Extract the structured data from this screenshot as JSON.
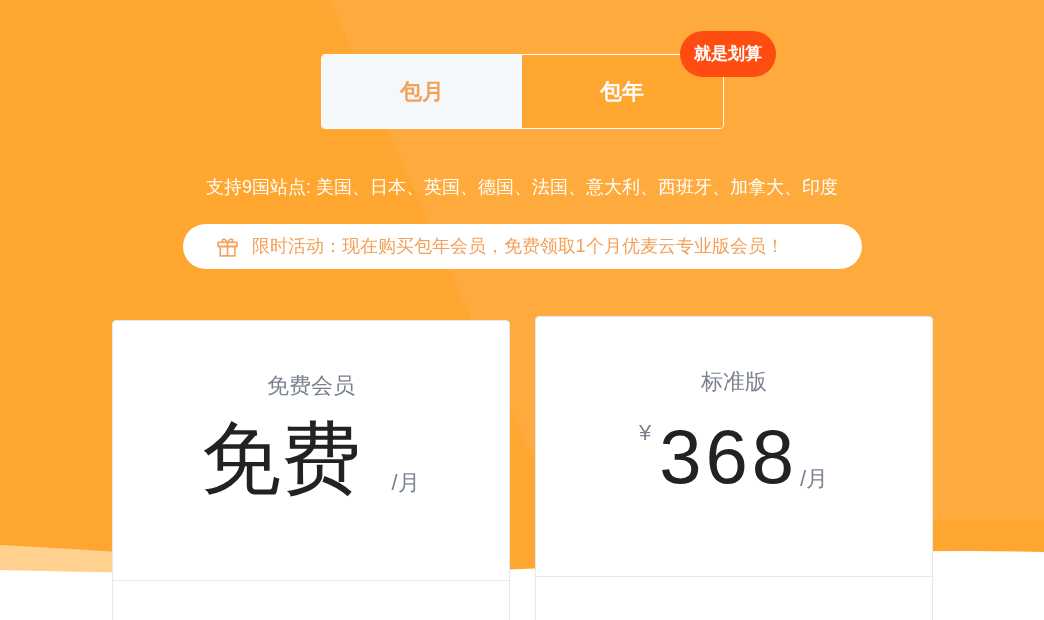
{
  "billing_tabs": [
    {
      "label": "包月",
      "selected": false
    },
    {
      "label": "包年",
      "selected": true
    }
  ],
  "badge": "就是划算",
  "sites_text": "支持9国站点: 美国、日本、英国、德国、法国、意大利、西班牙、加拿大、印度",
  "promo": {
    "text": "限时活动：现在购买包年会员，免费领取1个月优麦云专业版会员！"
  },
  "plans": [
    {
      "name": "免费会员",
      "price": "免费",
      "unit": "/月"
    },
    {
      "name": "标准版",
      "currency": "¥",
      "price": "368",
      "unit": "/月"
    }
  ]
}
